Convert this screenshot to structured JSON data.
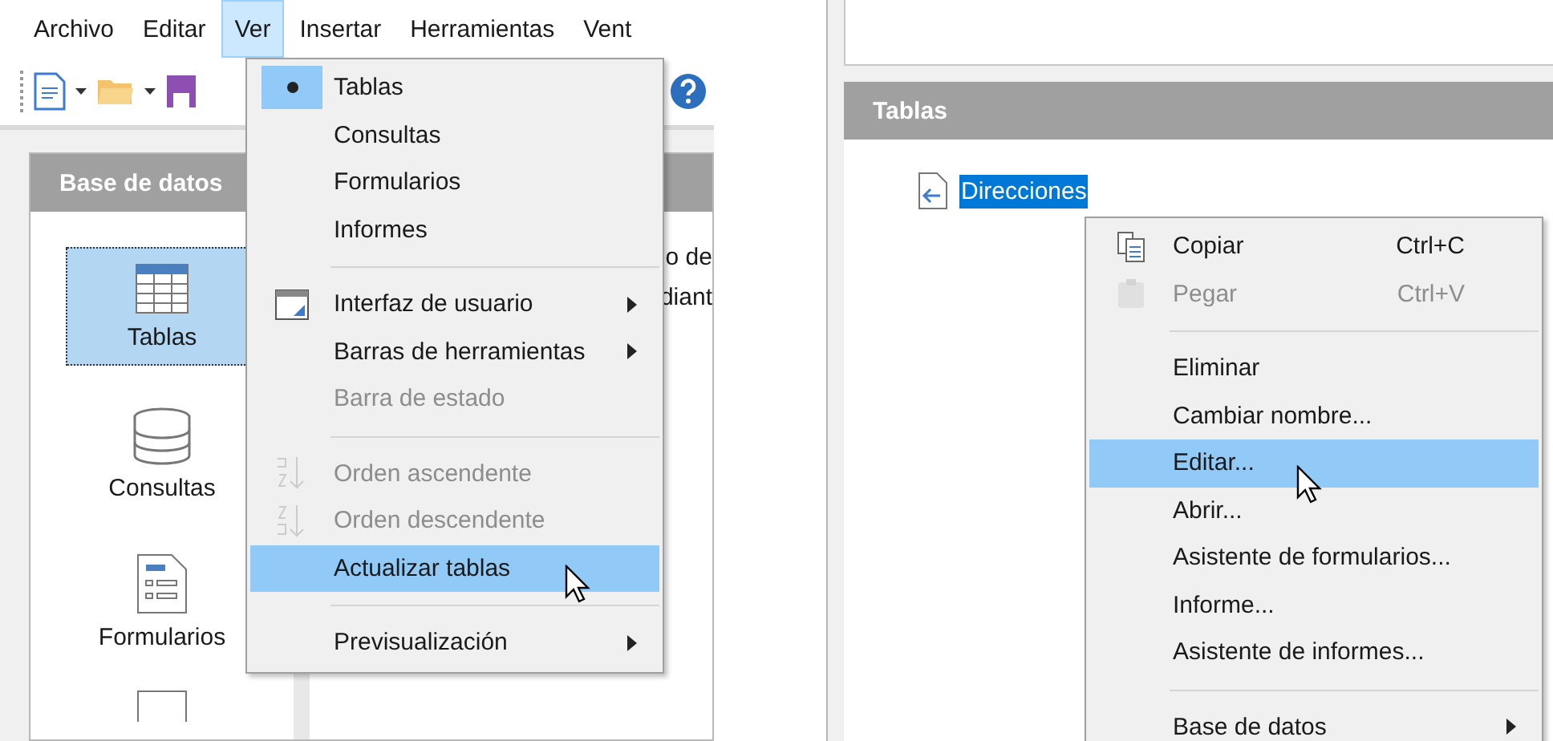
{
  "left": {
    "menubar": [
      {
        "label": "Archivo",
        "selected": false
      },
      {
        "label": "Editar",
        "selected": false
      },
      {
        "label": "Ver",
        "selected": true
      },
      {
        "label": "Insertar",
        "selected": false
      },
      {
        "label": "Herramientas",
        "selected": false
      },
      {
        "label": "Vent",
        "selected": false
      }
    ],
    "sidebar": {
      "title": "Base de datos",
      "items": [
        {
          "label": "Tablas",
          "selected": true
        },
        {
          "label": "Consultas",
          "selected": false
        },
        {
          "label": "Formularios",
          "selected": false
        }
      ]
    },
    "content_text": [
      "o de",
      "diant"
    ],
    "view_menu": [
      {
        "kind": "radio",
        "label": "Tablas",
        "checked": true,
        "selected": false,
        "disabled": false
      },
      {
        "kind": "radio",
        "label": "Consultas",
        "checked": false,
        "selected": false,
        "disabled": false
      },
      {
        "kind": "radio",
        "label": "Formularios",
        "checked": false,
        "selected": false,
        "disabled": false
      },
      {
        "kind": "radio",
        "label": "Informes",
        "checked": false,
        "selected": false,
        "disabled": false
      },
      {
        "kind": "separator"
      },
      {
        "kind": "submenu",
        "label": "Interfaz de usuario",
        "selected": false,
        "disabled": false
      },
      {
        "kind": "submenu",
        "label": "Barras de herramientas",
        "selected": false,
        "disabled": false
      },
      {
        "kind": "item",
        "label": "Barra de estado",
        "selected": false,
        "disabled": true
      },
      {
        "kind": "separator"
      },
      {
        "kind": "item",
        "label": "Orden ascendente",
        "selected": false,
        "disabled": true
      },
      {
        "kind": "item",
        "label": "Orden descendente",
        "selected": false,
        "disabled": true
      },
      {
        "kind": "item",
        "label": "Actualizar tablas",
        "selected": true,
        "disabled": false
      },
      {
        "kind": "separator"
      },
      {
        "kind": "submenu",
        "label": "Previsualización",
        "selected": false,
        "disabled": false
      }
    ]
  },
  "right": {
    "section_title": "Tablas",
    "table_item": {
      "label": "Direcciones",
      "selected": true
    },
    "context_menu": [
      {
        "kind": "item",
        "label": "Copiar",
        "shortcut": "Ctrl+C",
        "selected": false,
        "disabled": false
      },
      {
        "kind": "item",
        "label": "Pegar",
        "shortcut": "Ctrl+V",
        "selected": false,
        "disabled": true
      },
      {
        "kind": "separator"
      },
      {
        "kind": "item",
        "label": "Eliminar",
        "selected": false,
        "disabled": false
      },
      {
        "kind": "item",
        "label": "Cambiar nombre...",
        "selected": false,
        "disabled": false
      },
      {
        "kind": "item",
        "label": "Editar...",
        "selected": true,
        "disabled": false
      },
      {
        "kind": "item",
        "label": "Abrir...",
        "selected": false,
        "disabled": false
      },
      {
        "kind": "item",
        "label": "Asistente de formularios...",
        "selected": false,
        "disabled": false
      },
      {
        "kind": "item",
        "label": "Informe...",
        "selected": false,
        "disabled": false
      },
      {
        "kind": "item",
        "label": "Asistente de informes...",
        "selected": false,
        "disabled": false
      },
      {
        "kind": "separator"
      },
      {
        "kind": "submenu",
        "label": "Base de datos",
        "selected": false,
        "disabled": false
      }
    ]
  }
}
